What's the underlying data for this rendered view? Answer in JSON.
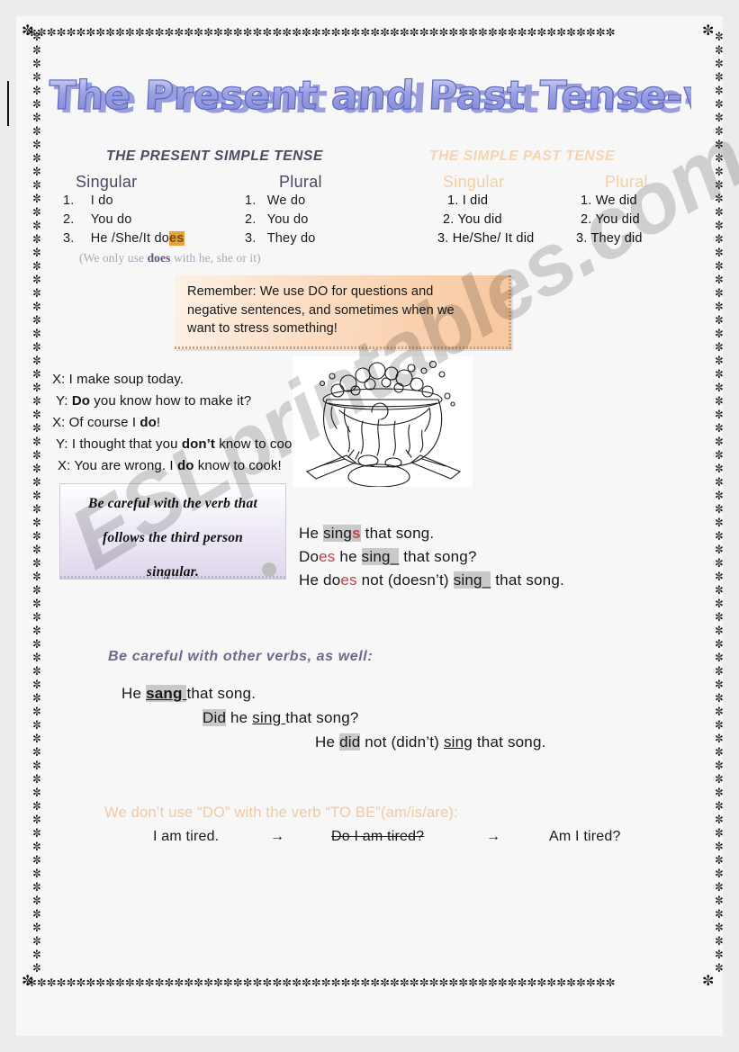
{
  "page": {
    "title": "The Present and Past Tense-verb To Do",
    "watermark": "ESLprintables.com",
    "background_color": "#ececec",
    "sheet_color": "#f7f7f7",
    "border_ornament": "✼"
  },
  "present": {
    "heading": "THE PRESENT SIMPLE TENSE",
    "heading_color": "#4a4a63",
    "singular_label": "Singular",
    "plural_label": "Plural",
    "singular": [
      {
        "num": "1.",
        "text": "I do"
      },
      {
        "num": "2.",
        "text": "You do"
      },
      {
        "num": "3.",
        "text": "He /She/It do",
        "suffix": "es",
        "suffix_color": "#d99a3c"
      }
    ],
    "plural": [
      {
        "num": "1.",
        "text": "We do"
      },
      {
        "num": "2.",
        "text": "You do"
      },
      {
        "num": "3.",
        "text": "They do"
      }
    ],
    "note_pre": "(We only use ",
    "note_bold": "does",
    "note_post": " with he, she or it)"
  },
  "past": {
    "heading": "THE SIMPLE PAST TENSE",
    "heading_color": "#f5d3ae",
    "singular_label": "Singular",
    "plural_label": "Plural",
    "singular": [
      {
        "text": "1. I did"
      },
      {
        "text": "2. You did"
      },
      {
        "text": "3. He/She/ It did"
      }
    ],
    "plural": [
      {
        "text": "1. We did"
      },
      {
        "text": "2. You did"
      },
      {
        "text": "3. They did"
      }
    ]
  },
  "remember": {
    "line1": "Remember:   We use DO for questions and",
    "line2": "negative sentences, and sometimes when we",
    "line3": "want to stress something!",
    "bg_start": "#fdf1e6",
    "bg_end": "#f8c79d"
  },
  "dialogue": [
    {
      "speaker": "X:",
      "pre": " I make soup today.",
      "bold": "",
      "post": ""
    },
    {
      "speaker": "Y:",
      "pre": " ",
      "bold": "Do",
      "post": " you know how to make it?"
    },
    {
      "speaker": "X:",
      "pre": " Of course I ",
      "bold": "do",
      "post": "!"
    },
    {
      "speaker": "Y:",
      "pre": " I thought that you ",
      "bold": "don’t",
      "post": " know to cook."
    },
    {
      "speaker": "X:",
      "pre": " You are wrong. I ",
      "bold": "do",
      "post": " know to cook!"
    }
  ],
  "clipart": {
    "name": "bubbling-cauldron-on-fire"
  },
  "purple_box": {
    "line1": "Be careful with the verb that",
    "line2": "follows the third person",
    "line3": "singular.",
    "bg_top": "#fefeff",
    "bg_bottom": "#ddd6ec"
  },
  "sings_examples": [
    {
      "parts": [
        {
          "t": "He ",
          "style": "plain"
        },
        {
          "t": "sing",
          "style": "hl"
        },
        {
          "t": "s",
          "style": "hl-red-bold"
        },
        {
          "t": " that song.",
          "style": "plain"
        }
      ]
    },
    {
      "parts": [
        {
          "t": "Do",
          "style": "plain"
        },
        {
          "t": "es",
          "style": "red"
        },
        {
          "t": " he ",
          "style": "plain"
        },
        {
          "t": "sing_",
          "style": "hl"
        },
        {
          "t": " that song?",
          "style": "plain"
        }
      ]
    },
    {
      "parts": [
        {
          "t": "He do",
          "style": "plain"
        },
        {
          "t": "es",
          "style": "red"
        },
        {
          "t": " not (doesn’t) ",
          "style": "plain"
        },
        {
          "t": "sing_",
          "style": "hl"
        },
        {
          "t": " that song.",
          "style": "plain"
        }
      ]
    }
  ],
  "other_verbs": {
    "heading": "Be careful with other verbs, as well:",
    "heading_color": "#6b6a8d",
    "lines": [
      {
        "indent": 135,
        "parts": [
          {
            "t": "He ",
            "style": "plain"
          },
          {
            "t": "sang ",
            "style": "hl-bold-ul"
          },
          {
            "t": "that song.",
            "style": "plain"
          }
        ]
      },
      {
        "indent": 225,
        "parts": [
          {
            "t": "Did",
            "style": "hl"
          },
          {
            "t": " he ",
            "style": "plain"
          },
          {
            "t": "sing ",
            "style": "ul"
          },
          {
            "t": " that song?",
            "style": "plain"
          }
        ]
      },
      {
        "indent": 350,
        "parts": [
          {
            "t": "He ",
            "style": "plain"
          },
          {
            "t": "did",
            "style": "hl"
          },
          {
            "t": " not (didn’t) ",
            "style": "plain"
          },
          {
            "t": "sing",
            "style": "ul"
          },
          {
            "t": " that song.",
            "style": "plain"
          }
        ]
      }
    ]
  },
  "to_be": {
    "heading": "We don’t use “DO” with the verb “TO BE”(am/is/are):",
    "heading_color": "#f0c9a2",
    "example_1": "I am tired.",
    "arrow": "→",
    "example_2": "Do I am tired?",
    "example_3": "Am I tired?"
  }
}
